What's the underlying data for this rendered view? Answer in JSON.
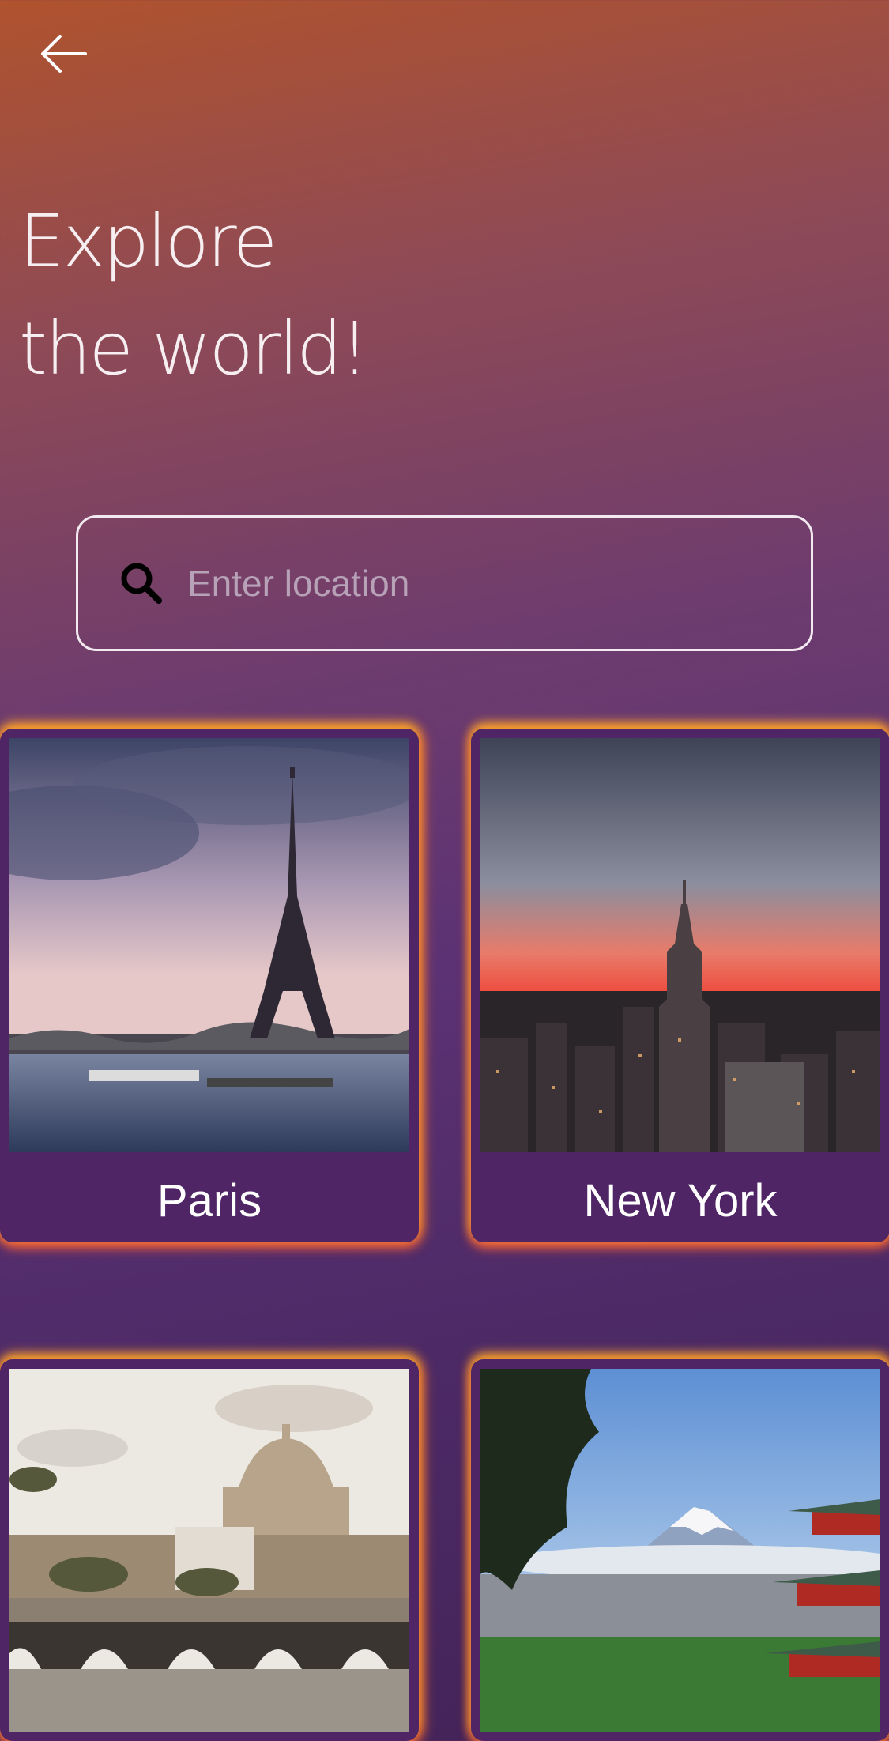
{
  "header": {
    "back_icon": "arrow-left-icon"
  },
  "hero": {
    "title_line1": "Explore",
    "title_line2": "the world!"
  },
  "search": {
    "placeholder": "Enter location",
    "icon": "search-icon"
  },
  "destinations": [
    {
      "name": "Paris"
    },
    {
      "name": "New York"
    },
    {
      "name": "",
      "photo": "rome-vatican-photo"
    },
    {
      "name": "",
      "photo": "mount-fuji-pagoda-photo"
    }
  ],
  "colors": {
    "card_bg": "#4f2566",
    "glow": "#ff9a2a",
    "text": "#ffffff"
  }
}
